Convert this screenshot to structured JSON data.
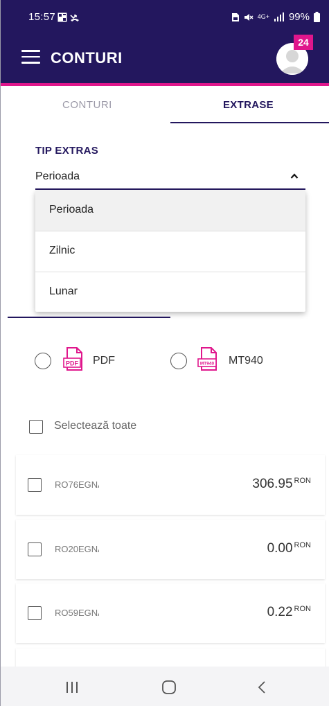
{
  "status_bar": {
    "time": "15:57",
    "battery": "99%",
    "network": "4G+"
  },
  "header": {
    "title": "CONTURI",
    "notification_count": "24"
  },
  "tabs": [
    {
      "label": "CONTURI"
    },
    {
      "label": "EXTRASE"
    }
  ],
  "statement_type": {
    "label": "TIP EXTRAS",
    "selected": "Perioada",
    "options": [
      "Perioada",
      "Zilnic",
      "Lunar"
    ]
  },
  "formats": [
    {
      "label": "PDF",
      "icon": "pdf-file-icon"
    },
    {
      "label": "MT940",
      "icon": "mt940-file-icon"
    }
  ],
  "select_all_label": "Selectează toate",
  "accounts": [
    {
      "iban": "RO76EGNA",
      "amount": "306.95",
      "currency": "RON"
    },
    {
      "iban": "RO20EGNA",
      "amount": "0.00",
      "currency": "RON"
    },
    {
      "iban": "RO59EGNA",
      "amount": "0.22",
      "currency": "RON"
    }
  ],
  "colors": {
    "primary": "#23175e",
    "accent": "#e0168c"
  }
}
